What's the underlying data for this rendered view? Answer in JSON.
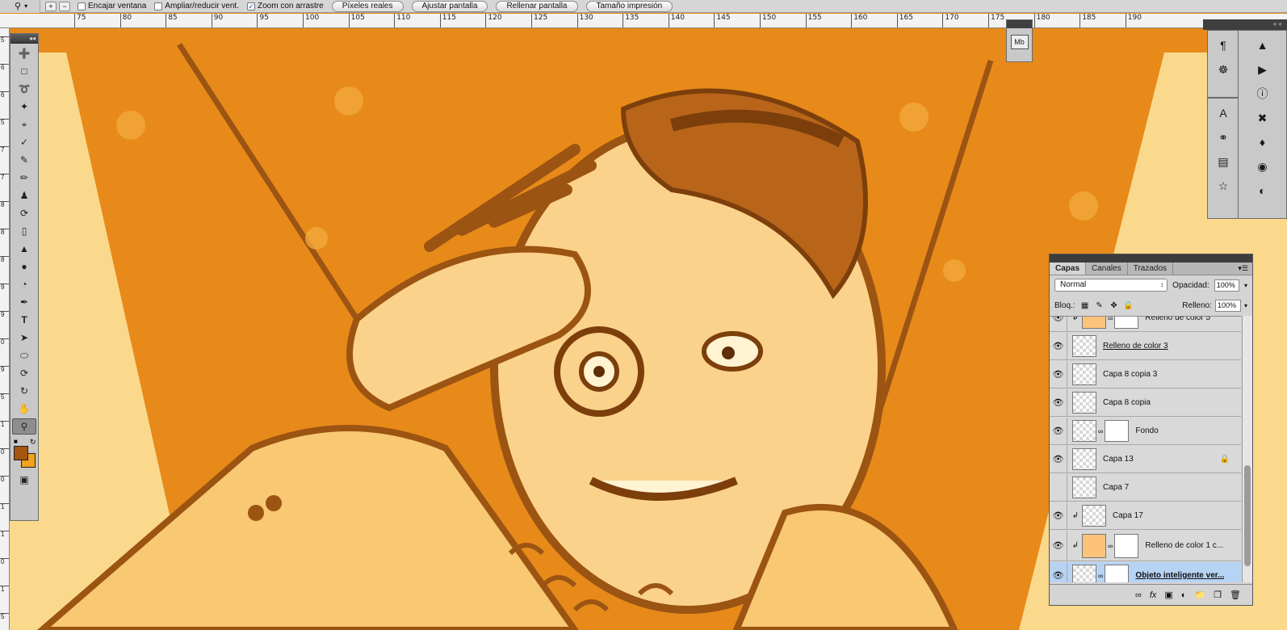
{
  "options_bar": {
    "tool_icon": "zoom-icon",
    "check_resize_window": {
      "label": "Encajar ventana",
      "checked": false
    },
    "check_zoom_all": {
      "label": "Ampliar/reducir vent.",
      "checked": false
    },
    "check_scrubby_zoom": {
      "label": "Zoom con arrastre",
      "checked": true
    },
    "buttons": [
      "Píxeles reales",
      "Ajustar pantalla",
      "Rellenar pantalla",
      "Tamaño impresión"
    ]
  },
  "ruler": {
    "top_labels": [
      "75",
      "80",
      "85",
      "90",
      "95",
      "100",
      "105",
      "110",
      "115",
      "120",
      "125",
      "130",
      "135",
      "140",
      "145",
      "150",
      "155",
      "160",
      "165",
      "170",
      "175",
      "180",
      "185",
      "190"
    ],
    "left_labels": [
      "5",
      "6",
      "6",
      "5",
      "7",
      "7",
      "8",
      "8",
      "8",
      "9",
      "9",
      "0",
      "9",
      "5",
      "1",
      "0",
      "0",
      "1",
      "1",
      "0",
      "1",
      "5"
    ]
  },
  "colors": {
    "foreground": "#a45510",
    "background": "#f0a21a",
    "accent_selection": "#b7d3f3"
  },
  "layers_panel": {
    "tabs": [
      "Capas",
      "Canales",
      "Trazados"
    ],
    "blend_mode": "Normal",
    "opacity_label": "Opacidad:",
    "opacity_value": "100%",
    "lock_label": "Bloq.:",
    "fill_label": "Relleno:",
    "fill_value": "100%",
    "layers": [
      {
        "name": "Relleno de color 5",
        "visible": true
      },
      {
        "name": "Relleno de color 3",
        "visible": true
      },
      {
        "name": "Capa 8 copia 3",
        "visible": true
      },
      {
        "name": "Capa 8 copia",
        "visible": true
      },
      {
        "name": "Fondo",
        "visible": true
      },
      {
        "name": "Capa 13",
        "visible": true,
        "locked": true
      },
      {
        "name": "Capa 7",
        "visible": false
      },
      {
        "name": "Capa 17",
        "visible": true
      },
      {
        "name": "Relleno de color 1 c...",
        "visible": true
      },
      {
        "name": "Objeto inteligente ver...",
        "visible": true,
        "selected": true
      }
    ]
  },
  "dock": {
    "collapsed_label": "« «",
    "panel_a_label": "Mb"
  }
}
